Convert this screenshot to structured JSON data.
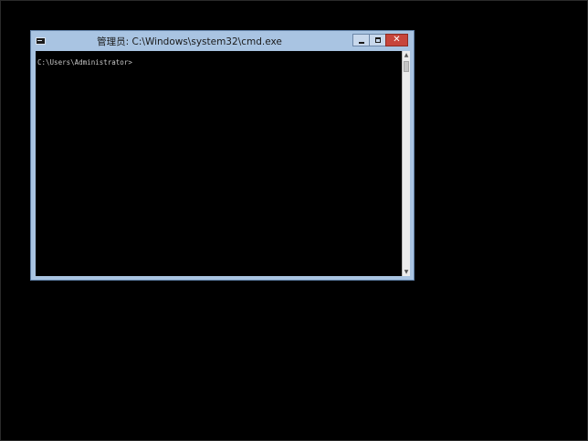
{
  "window": {
    "title": "管理员: C:\\Windows\\system32\\cmd.exe",
    "icon": "console-icon",
    "controls": {
      "minimize_icon": "minimize-icon",
      "maximize_icon": "maximize-icon",
      "close_icon": "close-icon",
      "close_glyph": "✕"
    }
  },
  "console": {
    "prompt": "C:\\Users\\Administrator>"
  },
  "scrollbar": {
    "up_glyph": "▲",
    "down_glyph": "▼"
  },
  "colors": {
    "desktop_background": "#000000",
    "window_frame": "#a9c4e2",
    "console_background": "#000000",
    "console_text": "#c8c8c8",
    "close_button": "#c7453b"
  }
}
